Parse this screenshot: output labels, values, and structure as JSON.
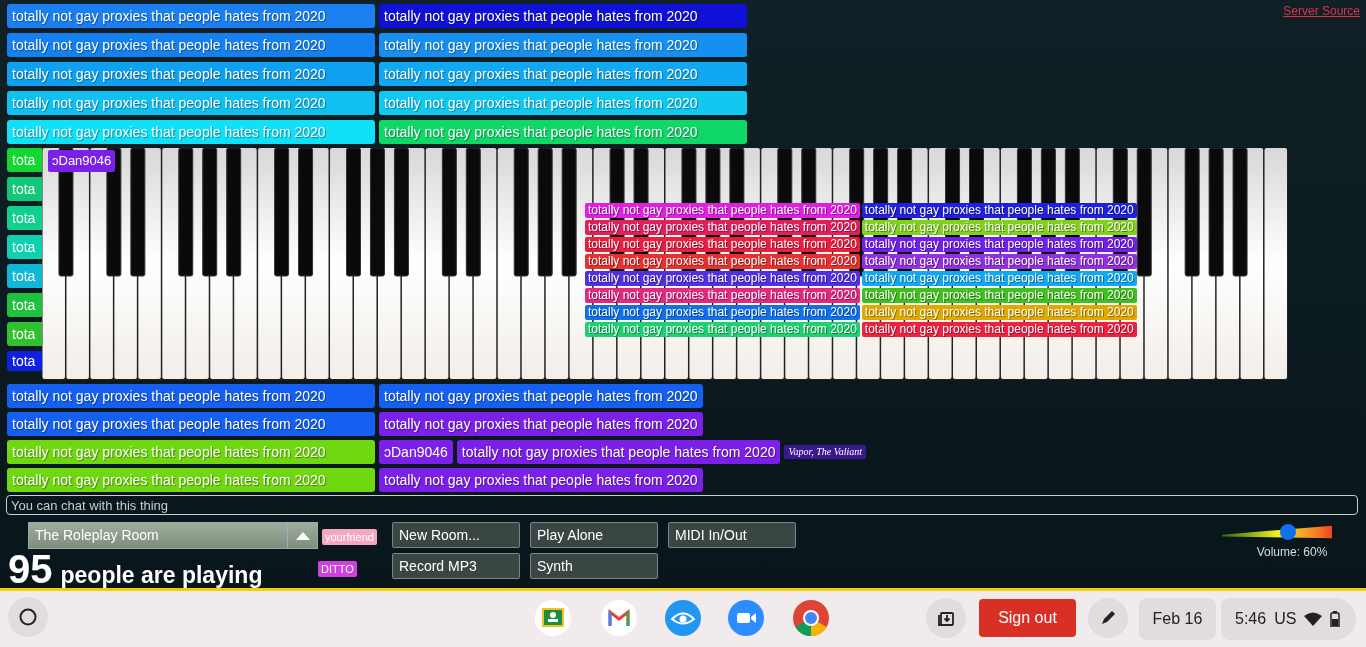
{
  "header": {
    "link": "Server Source"
  },
  "spam_top": [
    {
      "cells": [
        {
          "text": "totally not gay proxies that people hates from 2020",
          "color": "#1a7ff0"
        },
        {
          "text": "totally not gay proxies that people hates from 2020",
          "color": "#1010d8"
        }
      ]
    },
    {
      "cells": [
        {
          "text": "totally not gay proxies that people hates from 2020",
          "color": "#1580f0"
        },
        {
          "text": "totally not gay proxies that people hates from 2020",
          "color": "#1590f0"
        }
      ]
    },
    {
      "cells": [
        {
          "text": "totally not gay proxies that people hates from 2020",
          "color": "#10a0f0"
        },
        {
          "text": "totally not gay proxies that people hates from 2020",
          "color": "#10a8f0"
        }
      ]
    },
    {
      "cells": [
        {
          "text": "totally not gay proxies that people hates from 2020",
          "color": "#10c0f0"
        },
        {
          "text": "totally not gay proxies that people hates from 2020",
          "color": "#10c8f0"
        }
      ]
    },
    {
      "cells": [
        {
          "text": "totally not gay proxies that people hates from 2020",
          "color": "#10e0f8"
        },
        {
          "text": "totally not gay proxies that people hates from 2020",
          "color": "#10d868"
        }
      ]
    }
  ],
  "spam_strip": [
    {
      "text": "tota",
      "color": "#10d830"
    },
    {
      "text": "tota",
      "color": "#10c878"
    },
    {
      "text": "tota",
      "color": "#10d090"
    },
    {
      "text": "tota",
      "color": "#10d0b0"
    },
    {
      "text": "tota",
      "color": "#10b8d8"
    },
    {
      "text": "tota",
      "color": "#20c040"
    },
    {
      "text": "tota",
      "color": "#30c030"
    },
    {
      "text": "tota",
      "color": "#1020e0"
    }
  ],
  "piano_tag": {
    "text": "ɔDan9046",
    "color": "#7a20e8"
  },
  "cluster": [
    {
      "text": "totally not gay proxies that people hates from 2020",
      "color": "#e020e0"
    },
    {
      "text": "totally not gay proxies that people hates from 2020",
      "color": "#2020e0"
    },
    {
      "text": "totally not gay proxies that people hates from 2020",
      "color": "#e0205a"
    },
    {
      "text": "totally not gay proxies that people hates from 2020",
      "color": "#80d020"
    },
    {
      "text": "totally not gay proxies that people hates from 2020",
      "color": "#e82040"
    },
    {
      "text": "totally not gay proxies that people hates from 2020",
      "color": "#7020e8"
    },
    {
      "text": "totally not gay proxies that people hates from 2020",
      "color": "#e83030"
    },
    {
      "text": "totally not gay proxies that people hates from 2020",
      "color": "#9030e0"
    },
    {
      "text": "totally not gay proxies that people hates from 2020",
      "color": "#5030e0"
    },
    {
      "text": "totally not gay proxies that people hates from 2020",
      "color": "#10a8f0"
    },
    {
      "text": "totally not gay proxies that people hates from 2020",
      "color": "#e02a80"
    },
    {
      "text": "totally not gay proxies that people hates from 2020",
      "color": "#40c020"
    },
    {
      "text": "totally not gay proxies that people hates from 2020",
      "color": "#1070e8"
    },
    {
      "text": "totally not gay proxies that people hates from 2020",
      "color": "#e0a800"
    },
    {
      "text": "totally not gay proxies that people hates from 2020",
      "color": "#20d070"
    },
    {
      "text": "totally not gay proxies that people hates from 2020",
      "color": "#f02040"
    }
  ],
  "spam_bottom": [
    {
      "cells": [
        {
          "kind": "message",
          "text": "totally not gay proxies that people hates from 2020",
          "color": "#1560f0"
        },
        {
          "kind": "message",
          "text": "totally not gay proxies that people hates from 2020",
          "color": "#1560f0"
        }
      ]
    },
    {
      "cells": [
        {
          "kind": "message",
          "text": "totally not gay proxies that people hates from 2020",
          "color": "#1560f0"
        },
        {
          "kind": "message",
          "text": "totally not gay proxies that people hates from 2020",
          "color": "#7a20e8"
        }
      ]
    },
    {
      "cells": [
        {
          "kind": "message",
          "text": "totally not gay proxies that people hates from 2020",
          "color": "#70d810"
        },
        {
          "kind": "name_tag",
          "text": "ɔDan9046",
          "color": "#7a20e8"
        },
        {
          "kind": "message",
          "text": "totally not gay proxies that people hates from 2020",
          "color": "#7a20e8"
        },
        {
          "kind": "cursor_tag",
          "text": "Vapor, The Valiant",
          "color": "#3a1890"
        }
      ]
    },
    {
      "cells": [
        {
          "kind": "message",
          "text": "totally not gay proxies that people hates from 2020",
          "color": "#70d810"
        },
        {
          "kind": "message",
          "text": "totally not gay proxies that people hates from 2020",
          "color": "#7a20e8"
        }
      ]
    }
  ],
  "chat": {
    "placeholder": "You can chat with this thing"
  },
  "room": {
    "name": "The Roleplay Room"
  },
  "players": {
    "count": "95",
    "label": "people are playing"
  },
  "tags": [
    {
      "text": "yourfriend",
      "color": "#f4a8c0"
    },
    {
      "text": "DITTO",
      "color": "#d040e0"
    }
  ],
  "buttons": [
    "New Room...",
    "Play Alone",
    "MIDI In/Out",
    "Record MP3",
    "Synth"
  ],
  "volume": {
    "level": 0.6,
    "reading": "Volume: 60%"
  },
  "taskbar": {
    "sign_out": "Sign out",
    "date": "Feb 16",
    "time": "5:46",
    "locale": "US"
  }
}
